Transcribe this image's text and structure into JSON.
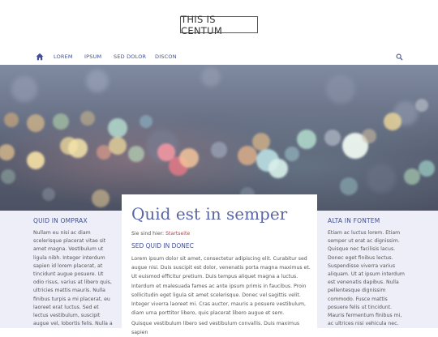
{
  "site": {
    "logo": "THIS IS CENTUM"
  },
  "nav": {
    "items": [
      "LOREM",
      "IPSUM",
      "SED DOLOR",
      "DISCON"
    ]
  },
  "left": {
    "heading": "QUID IN OMPRAX",
    "text": "Nullam eu nisi ac diam scelerisque placerat vitae sit amet magna. Vestibulum ut ligula nibh. Integer interdum sapien id lorem placerat, at tincidunt augue posuere. Ut odio risus, varius at libero quis, ultricies mattis mauris. Nulla finibus turpis a mi placerat, eu laoreet erat luctus. Sed et lectus vestibulum, suscipit augue vel, lobortis felis. Nulla a"
  },
  "main": {
    "title": "Quid est in semper",
    "breadcrumb_prefix": "Sie sind hier:",
    "breadcrumb_link": "Startseite",
    "subheading": "SED QUID IN DONEC",
    "paragraph1": "Lorem ipsum dolor sit amet, consectetur adipiscing elit. Curabitur sed augue nisi. Duis suscipit est dolor, venenatis porta magna maximus et. Ut euismod efficitur pretium. Duis tempus aliquet magna a luctus. Interdum et malesuada fames ac ante ipsum primis in faucibus. Proin sollicitudin eget ligula sit amet scelerisque. Donec vel sagittis velit. Integer viverra laoreet mi. Cras auctor, mauris a posuere vestibulum, diam urna porttitor libero, quis placerat libero augue et sem.",
    "paragraph2": "Quisque vestibulum libero sed vestibulum convallis. Duis maximus sapien"
  },
  "right": {
    "heading": "ALTA IN FONTEM",
    "text": "Etiam ac luctus lorem. Etiam semper ut erat ac dignissim. Quisque nec facilisis lacus. Donec eget finibus lectus. Suspendisse viverra varius aliquam. Ut at ipsum interdum est venenatis dapibus. Nulla pellentesque dignissim commodo. Fusce mattis posuere felis ut tincidunt. Mauris fermentum finibus mi, ac ultrices nisi vehicula nec."
  },
  "colors": {
    "accent": "#3f4f9a",
    "title": "#5a66a8",
    "link": "#b0404a",
    "band": "#edeef7"
  }
}
